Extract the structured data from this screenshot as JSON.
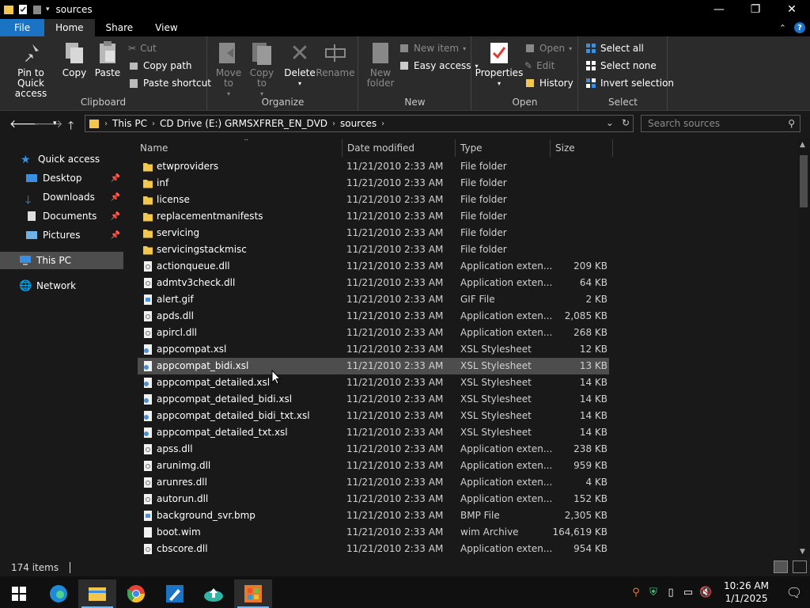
{
  "window": {
    "title": "sources",
    "controls": {
      "minimize": "—",
      "maximize": "❐",
      "close": "✕"
    }
  },
  "ribbon_tabs": [
    {
      "label": "File"
    },
    {
      "label": "Home"
    },
    {
      "label": "Share"
    },
    {
      "label": "View"
    }
  ],
  "ribbon": {
    "clipboard": {
      "label": "Clipboard",
      "pin": "Pin to Quick access",
      "copy": "Copy",
      "paste": "Paste",
      "cut": "Cut",
      "copy_path": "Copy path",
      "paste_shortcut": "Paste shortcut"
    },
    "organize": {
      "label": "Organize",
      "move_to": "Move to",
      "copy_to": "Copy to",
      "delete": "Delete",
      "rename": "Rename"
    },
    "new": {
      "label": "New",
      "new_folder": "New folder",
      "new_item": "New item",
      "easy_access": "Easy access"
    },
    "open": {
      "label": "Open",
      "properties": "Properties",
      "open": "Open",
      "edit": "Edit",
      "history": "History"
    },
    "select": {
      "label": "Select",
      "select_all": "Select all",
      "select_none": "Select none",
      "invert": "Invert selection"
    }
  },
  "address": {
    "crumbs": [
      "This PC",
      "CD Drive (E:) GRMSXFRER_EN_DVD",
      "sources"
    ],
    "search_placeholder": "Search sources"
  },
  "nav": {
    "quick_access": "Quick access",
    "desktop": "Desktop",
    "downloads": "Downloads",
    "documents": "Documents",
    "pictures": "Pictures",
    "this_pc": "This PC",
    "network": "Network"
  },
  "columns": {
    "name": "Name",
    "date": "Date modified",
    "type": "Type",
    "size": "Size"
  },
  "files": [
    {
      "name": "etwproviders",
      "date": "11/21/2010 2:33 AM",
      "type": "File folder",
      "size": "",
      "kind": "folder"
    },
    {
      "name": "inf",
      "date": "11/21/2010 2:33 AM",
      "type": "File folder",
      "size": "",
      "kind": "folder"
    },
    {
      "name": "license",
      "date": "11/21/2010 2:33 AM",
      "type": "File folder",
      "size": "",
      "kind": "folder"
    },
    {
      "name": "replacementmanifests",
      "date": "11/21/2010 2:33 AM",
      "type": "File folder",
      "size": "",
      "kind": "folder"
    },
    {
      "name": "servicing",
      "date": "11/21/2010 2:33 AM",
      "type": "File folder",
      "size": "",
      "kind": "folder"
    },
    {
      "name": "servicingstackmisc",
      "date": "11/21/2010 2:33 AM",
      "type": "File folder",
      "size": "",
      "kind": "folder"
    },
    {
      "name": "actionqueue.dll",
      "date": "11/21/2010 2:33 AM",
      "type": "Application exten...",
      "size": "209 KB",
      "kind": "dll"
    },
    {
      "name": "admtv3check.dll",
      "date": "11/21/2010 2:33 AM",
      "type": "Application exten...",
      "size": "64 KB",
      "kind": "dll"
    },
    {
      "name": "alert.gif",
      "date": "11/21/2010 2:33 AM",
      "type": "GIF File",
      "size": "2 KB",
      "kind": "image"
    },
    {
      "name": "apds.dll",
      "date": "11/21/2010 2:33 AM",
      "type": "Application exten...",
      "size": "2,085 KB",
      "kind": "dll"
    },
    {
      "name": "apircl.dll",
      "date": "11/21/2010 2:33 AM",
      "type": "Application exten...",
      "size": "268 KB",
      "kind": "dll"
    },
    {
      "name": "appcompat.xsl",
      "date": "11/21/2010 2:33 AM",
      "type": "XSL Stylesheet",
      "size": "12 KB",
      "kind": "xsl"
    },
    {
      "name": "appcompat_bidi.xsl",
      "date": "11/21/2010 2:33 AM",
      "type": "XSL Stylesheet",
      "size": "13 KB",
      "kind": "xsl"
    },
    {
      "name": "appcompat_detailed.xsl",
      "date": "11/21/2010 2:33 AM",
      "type": "XSL Stylesheet",
      "size": "14 KB",
      "kind": "xsl"
    },
    {
      "name": "appcompat_detailed_bidi.xsl",
      "date": "11/21/2010 2:33 AM",
      "type": "XSL Stylesheet",
      "size": "14 KB",
      "kind": "xsl"
    },
    {
      "name": "appcompat_detailed_bidi_txt.xsl",
      "date": "11/21/2010 2:33 AM",
      "type": "XSL Stylesheet",
      "size": "14 KB",
      "kind": "xsl"
    },
    {
      "name": "appcompat_detailed_txt.xsl",
      "date": "11/21/2010 2:33 AM",
      "type": "XSL Stylesheet",
      "size": "14 KB",
      "kind": "xsl"
    },
    {
      "name": "apss.dll",
      "date": "11/21/2010 2:33 AM",
      "type": "Application exten...",
      "size": "238 KB",
      "kind": "dll"
    },
    {
      "name": "arunimg.dll",
      "date": "11/21/2010 2:33 AM",
      "type": "Application exten...",
      "size": "959 KB",
      "kind": "dll"
    },
    {
      "name": "arunres.dll",
      "date": "11/21/2010 2:33 AM",
      "type": "Application exten...",
      "size": "4 KB",
      "kind": "dll"
    },
    {
      "name": "autorun.dll",
      "date": "11/21/2010 2:33 AM",
      "type": "Application exten...",
      "size": "152 KB",
      "kind": "dll"
    },
    {
      "name": "background_svr.bmp",
      "date": "11/21/2010 2:33 AM",
      "type": "BMP File",
      "size": "2,305 KB",
      "kind": "image"
    },
    {
      "name": "boot.wim",
      "date": "11/21/2010 2:33 AM",
      "type": "wim Archive",
      "size": "164,619 KB",
      "kind": "file"
    },
    {
      "name": "cbscore.dll",
      "date": "11/21/2010 2:33 AM",
      "type": "Application exten...",
      "size": "954 KB",
      "kind": "dll"
    }
  ],
  "hover_row_index": 12,
  "status": {
    "items": "174 items"
  },
  "taskbar": {
    "time": "10:26 AM",
    "date": "1/1/2025"
  },
  "colors": {
    "accent": "#1a73c5",
    "folder": "#f3c64d",
    "bg": "#191919"
  }
}
